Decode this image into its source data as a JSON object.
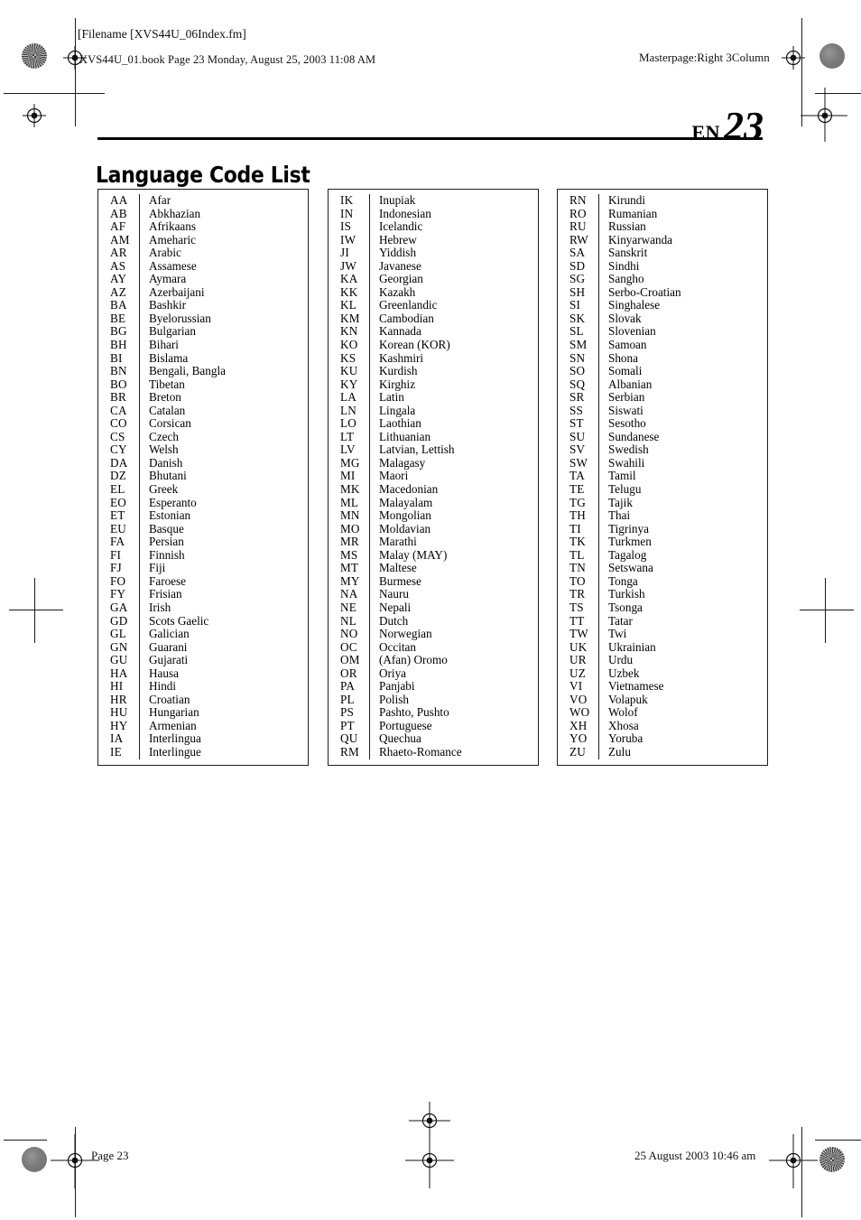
{
  "document": {
    "header": {
      "filename_label": "[Filename [XVS44U_06Index.fm]",
      "book_line": "XVS44U_01.book  Page 23  Monday, August 25, 2003  11:08 AM",
      "masterpage_label": "Masterpage:Right 3Column"
    },
    "page_marker": {
      "locale": "EN",
      "number": "23"
    },
    "title": "Language Code List",
    "footer": {
      "page_label": "Page 23",
      "timestamp": "25 August 2003 10:46 am"
    },
    "colors": {
      "text": "#000000",
      "rule": "#1f1f1f",
      "page_background": "#ffffff"
    }
  },
  "tables": [
    {
      "id": "column-1",
      "rows": [
        {
          "code": "AA",
          "language": "Afar"
        },
        {
          "code": "AB",
          "language": "Abkhazian"
        },
        {
          "code": "AF",
          "language": "Afrikaans"
        },
        {
          "code": "AM",
          "language": "Ameharic"
        },
        {
          "code": "AR",
          "language": "Arabic"
        },
        {
          "code": "AS",
          "language": "Assamese"
        },
        {
          "code": "AY",
          "language": "Aymara"
        },
        {
          "code": "AZ",
          "language": "Azerbaijani"
        },
        {
          "code": "BA",
          "language": "Bashkir"
        },
        {
          "code": "BE",
          "language": "Byelorussian"
        },
        {
          "code": "BG",
          "language": "Bulgarian"
        },
        {
          "code": "BH",
          "language": "Bihari"
        },
        {
          "code": "BI",
          "language": "Bislama"
        },
        {
          "code": "BN",
          "language": "Bengali, Bangla"
        },
        {
          "code": "BO",
          "language": "Tibetan"
        },
        {
          "code": "BR",
          "language": "Breton"
        },
        {
          "code": "CA",
          "language": "Catalan"
        },
        {
          "code": "CO",
          "language": "Corsican"
        },
        {
          "code": "CS",
          "language": "Czech"
        },
        {
          "code": "CY",
          "language": "Welsh"
        },
        {
          "code": "DA",
          "language": "Danish"
        },
        {
          "code": "DZ",
          "language": "Bhutani"
        },
        {
          "code": "EL",
          "language": "Greek"
        },
        {
          "code": "EO",
          "language": "Esperanto"
        },
        {
          "code": "ET",
          "language": "Estonian"
        },
        {
          "code": "EU",
          "language": "Basque"
        },
        {
          "code": "FA",
          "language": "Persian"
        },
        {
          "code": "FI",
          "language": "Finnish"
        },
        {
          "code": "FJ",
          "language": "Fiji"
        },
        {
          "code": "FO",
          "language": "Faroese"
        },
        {
          "code": "FY",
          "language": "Frisian"
        },
        {
          "code": "GA",
          "language": "Irish"
        },
        {
          "code": "GD",
          "language": "Scots Gaelic"
        },
        {
          "code": "GL",
          "language": "Galician"
        },
        {
          "code": "GN",
          "language": "Guarani"
        },
        {
          "code": "GU",
          "language": "Gujarati"
        },
        {
          "code": "HA",
          "language": "Hausa"
        },
        {
          "code": "HI",
          "language": "Hindi"
        },
        {
          "code": "HR",
          "language": "Croatian"
        },
        {
          "code": "HU",
          "language": "Hungarian"
        },
        {
          "code": "HY",
          "language": "Armenian"
        },
        {
          "code": "IA",
          "language": "Interlingua"
        },
        {
          "code": "IE",
          "language": "Interlingue"
        }
      ]
    },
    {
      "id": "column-2",
      "rows": [
        {
          "code": "IK",
          "language": "Inupiak"
        },
        {
          "code": "IN",
          "language": "Indonesian"
        },
        {
          "code": "IS",
          "language": "Icelandic"
        },
        {
          "code": "IW",
          "language": "Hebrew"
        },
        {
          "code": "JI",
          "language": "Yiddish"
        },
        {
          "code": "JW",
          "language": "Javanese"
        },
        {
          "code": "KA",
          "language": "Georgian"
        },
        {
          "code": "KK",
          "language": "Kazakh"
        },
        {
          "code": "KL",
          "language": "Greenlandic"
        },
        {
          "code": "KM",
          "language": "Cambodian"
        },
        {
          "code": "KN",
          "language": "Kannada"
        },
        {
          "code": "KO",
          "language": "Korean (KOR)"
        },
        {
          "code": "KS",
          "language": "Kashmiri"
        },
        {
          "code": "KU",
          "language": "Kurdish"
        },
        {
          "code": "KY",
          "language": "Kirghiz"
        },
        {
          "code": "LA",
          "language": "Latin"
        },
        {
          "code": "LN",
          "language": "Lingala"
        },
        {
          "code": "LO",
          "language": "Laothian"
        },
        {
          "code": "LT",
          "language": "Lithuanian"
        },
        {
          "code": "LV",
          "language": "Latvian, Lettish"
        },
        {
          "code": "MG",
          "language": "Malagasy"
        },
        {
          "code": "MI",
          "language": "Maori"
        },
        {
          "code": "MK",
          "language": "Macedonian"
        },
        {
          "code": "ML",
          "language": "Malayalam"
        },
        {
          "code": "MN",
          "language": "Mongolian"
        },
        {
          "code": "MO",
          "language": "Moldavian"
        },
        {
          "code": "MR",
          "language": "Marathi"
        },
        {
          "code": "MS",
          "language": "Malay (MAY)"
        },
        {
          "code": "MT",
          "language": "Maltese"
        },
        {
          "code": "MY",
          "language": "Burmese"
        },
        {
          "code": "NA",
          "language": "Nauru"
        },
        {
          "code": "NE",
          "language": "Nepali"
        },
        {
          "code": "NL",
          "language": "Dutch"
        },
        {
          "code": "NO",
          "language": "Norwegian"
        },
        {
          "code": "OC",
          "language": "Occitan"
        },
        {
          "code": "OM",
          "language": "(Afan) Oromo"
        },
        {
          "code": "OR",
          "language": "Oriya"
        },
        {
          "code": "PA",
          "language": "Panjabi"
        },
        {
          "code": "PL",
          "language": "Polish"
        },
        {
          "code": "PS",
          "language": "Pashto, Pushto"
        },
        {
          "code": "PT",
          "language": "Portuguese"
        },
        {
          "code": "QU",
          "language": "Quechua"
        },
        {
          "code": "RM",
          "language": "Rhaeto-Romance"
        }
      ]
    },
    {
      "id": "column-3",
      "rows": [
        {
          "code": "RN",
          "language": "Kirundi"
        },
        {
          "code": "RO",
          "language": "Rumanian"
        },
        {
          "code": "RU",
          "language": "Russian"
        },
        {
          "code": "RW",
          "language": "Kinyarwanda"
        },
        {
          "code": "SA",
          "language": "Sanskrit"
        },
        {
          "code": "SD",
          "language": "Sindhi"
        },
        {
          "code": "SG",
          "language": "Sangho"
        },
        {
          "code": "SH",
          "language": "Serbo-Croatian"
        },
        {
          "code": "SI",
          "language": "Singhalese"
        },
        {
          "code": "SK",
          "language": "Slovak"
        },
        {
          "code": "SL",
          "language": "Slovenian"
        },
        {
          "code": "SM",
          "language": "Samoan"
        },
        {
          "code": "SN",
          "language": "Shona"
        },
        {
          "code": "SO",
          "language": "Somali"
        },
        {
          "code": "SQ",
          "language": "Albanian"
        },
        {
          "code": "SR",
          "language": "Serbian"
        },
        {
          "code": "SS",
          "language": "Siswati"
        },
        {
          "code": "ST",
          "language": "Sesotho"
        },
        {
          "code": "SU",
          "language": "Sundanese"
        },
        {
          "code": "SV",
          "language": "Swedish"
        },
        {
          "code": "SW",
          "language": "Swahili"
        },
        {
          "code": "TA",
          "language": "Tamil"
        },
        {
          "code": "TE",
          "language": "Telugu"
        },
        {
          "code": "TG",
          "language": "Tajik"
        },
        {
          "code": "TH",
          "language": "Thai"
        },
        {
          "code": "TI",
          "language": "Tigrinya"
        },
        {
          "code": "TK",
          "language": "Turkmen"
        },
        {
          "code": "TL",
          "language": "Tagalog"
        },
        {
          "code": "TN",
          "language": "Setswana"
        },
        {
          "code": "TO",
          "language": "Tonga"
        },
        {
          "code": "TR",
          "language": "Turkish"
        },
        {
          "code": "TS",
          "language": "Tsonga"
        },
        {
          "code": "TT",
          "language": "Tatar"
        },
        {
          "code": "TW",
          "language": "Twi"
        },
        {
          "code": "UK",
          "language": "Ukrainian"
        },
        {
          "code": "UR",
          "language": "Urdu"
        },
        {
          "code": "UZ",
          "language": "Uzbek"
        },
        {
          "code": "VI",
          "language": "Vietnamese"
        },
        {
          "code": "VO",
          "language": "Volapuk"
        },
        {
          "code": "WO",
          "language": "Wolof"
        },
        {
          "code": "XH",
          "language": "Xhosa"
        },
        {
          "code": "YO",
          "language": "Yoruba"
        },
        {
          "code": "ZU",
          "language": "Zulu"
        }
      ]
    }
  ]
}
